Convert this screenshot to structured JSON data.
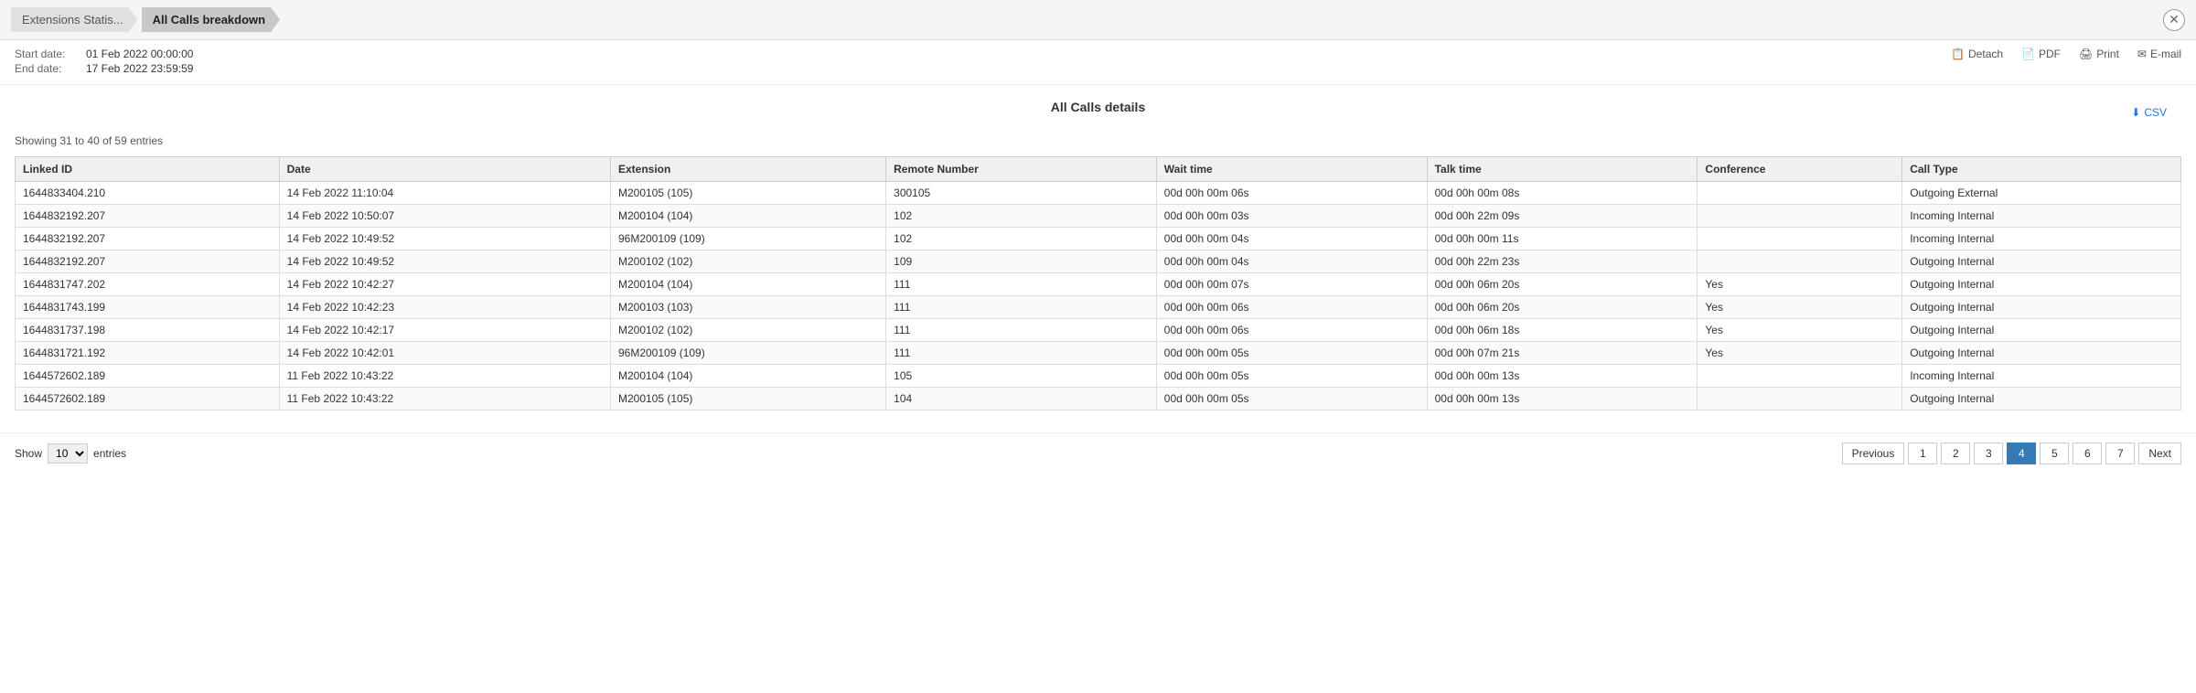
{
  "breadcrumb": {
    "items": [
      {
        "label": "Extensions Statis...",
        "active": false
      },
      {
        "label": "All Calls breakdown",
        "active": true
      }
    ]
  },
  "meta": {
    "start_label": "Start date:",
    "start_value": "01 Feb 2022 00:00:00",
    "end_label": "End date:",
    "end_value": "17 Feb 2022 23:59:59"
  },
  "actions": {
    "detach": "Detach",
    "pdf": "PDF",
    "print": "Print",
    "email": "E-mail"
  },
  "section_title": "All Calls details",
  "csv_label": "CSV",
  "entries_info": "Showing 31 to 40 of 59 entries",
  "show_label": "Show",
  "entries_label": "entries",
  "show_value": "10",
  "columns": [
    "Linked ID",
    "Date",
    "Extension",
    "Remote Number",
    "Wait time",
    "Talk time",
    "Conference",
    "Call Type"
  ],
  "rows": [
    {
      "linked_id": "1644833404.210",
      "date": "14 Feb 2022 11:10:04",
      "extension": "M200105 (105)",
      "remote_number": "300105",
      "wait_time": "00d 00h 00m 06s",
      "talk_time": "00d 00h 00m 08s",
      "conference": "",
      "call_type": "Outgoing External"
    },
    {
      "linked_id": "1644832192.207",
      "date": "14 Feb 2022 10:50:07",
      "extension": "M200104 (104)",
      "remote_number": "102",
      "wait_time": "00d 00h 00m 03s",
      "talk_time": "00d 00h 22m 09s",
      "conference": "",
      "call_type": "Incoming Internal"
    },
    {
      "linked_id": "1644832192.207",
      "date": "14 Feb 2022 10:49:52",
      "extension": "96M200109 (109)",
      "remote_number": "102",
      "wait_time": "00d 00h 00m 04s",
      "talk_time": "00d 00h 00m 11s",
      "conference": "",
      "call_type": "Incoming Internal"
    },
    {
      "linked_id": "1644832192.207",
      "date": "14 Feb 2022 10:49:52",
      "extension": "M200102 (102)",
      "remote_number": "109",
      "wait_time": "00d 00h 00m 04s",
      "talk_time": "00d 00h 22m 23s",
      "conference": "",
      "call_type": "Outgoing Internal"
    },
    {
      "linked_id": "1644831747.202",
      "date": "14 Feb 2022 10:42:27",
      "extension": "M200104 (104)",
      "remote_number": "111",
      "wait_time": "00d 00h 00m 07s",
      "talk_time": "00d 00h 06m 20s",
      "conference": "Yes",
      "call_type": "Outgoing Internal"
    },
    {
      "linked_id": "1644831743.199",
      "date": "14 Feb 2022 10:42:23",
      "extension": "M200103 (103)",
      "remote_number": "111",
      "wait_time": "00d 00h 00m 06s",
      "talk_time": "00d 00h 06m 20s",
      "conference": "Yes",
      "call_type": "Outgoing Internal"
    },
    {
      "linked_id": "1644831737.198",
      "date": "14 Feb 2022 10:42:17",
      "extension": "M200102 (102)",
      "remote_number": "111",
      "wait_time": "00d 00h 00m 06s",
      "talk_time": "00d 00h 06m 18s",
      "conference": "Yes",
      "call_type": "Outgoing Internal"
    },
    {
      "linked_id": "1644831721.192",
      "date": "14 Feb 2022 10:42:01",
      "extension": "96M200109 (109)",
      "remote_number": "111",
      "wait_time": "00d 00h 00m 05s",
      "talk_time": "00d 00h 07m 21s",
      "conference": "Yes",
      "call_type": "Outgoing Internal"
    },
    {
      "linked_id": "1644572602.189",
      "date": "11 Feb 2022 10:43:22",
      "extension": "M200104 (104)",
      "remote_number": "105",
      "wait_time": "00d 00h 00m 05s",
      "talk_time": "00d 00h 00m 13s",
      "conference": "",
      "call_type": "Incoming Internal"
    },
    {
      "linked_id": "1644572602.189",
      "date": "11 Feb 2022 10:43:22",
      "extension": "M200105 (105)",
      "remote_number": "104",
      "wait_time": "00d 00h 00m 05s",
      "talk_time": "00d 00h 00m 13s",
      "conference": "",
      "call_type": "Outgoing Internal"
    }
  ],
  "pagination": {
    "previous": "Previous",
    "next": "Next",
    "pages": [
      "1",
      "2",
      "3",
      "4",
      "5",
      "6",
      "7"
    ],
    "active_page": "4"
  }
}
